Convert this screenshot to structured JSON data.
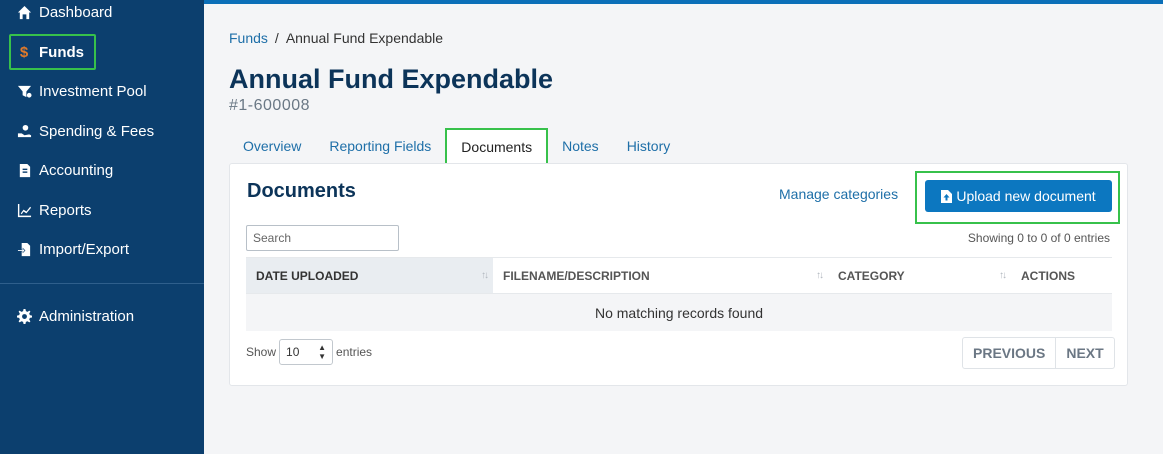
{
  "sidebar": {
    "items": [
      {
        "label": "Dashboard",
        "icon": "home-icon"
      },
      {
        "label": "Funds",
        "icon": "dollar-icon"
      },
      {
        "label": "Investment Pool",
        "icon": "funnel-icon"
      },
      {
        "label": "Spending & Fees",
        "icon": "hand-coin-icon"
      },
      {
        "label": "Accounting",
        "icon": "ledger-icon"
      },
      {
        "label": "Reports",
        "icon": "line-chart-icon"
      },
      {
        "label": "Import/Export",
        "icon": "file-transfer-icon"
      },
      {
        "label": "Administration",
        "icon": "gear-icon"
      }
    ],
    "funds_icon_glyph": "$"
  },
  "breadcrumb": {
    "parent": "Funds",
    "separator": "/",
    "current": "Annual Fund Expendable"
  },
  "page": {
    "title": "Annual Fund Expendable",
    "subtitle": "#1-600008"
  },
  "tabs": [
    {
      "label": "Overview"
    },
    {
      "label": "Reporting Fields"
    },
    {
      "label": "Documents"
    },
    {
      "label": "Notes"
    },
    {
      "label": "History"
    }
  ],
  "documents": {
    "title": "Documents",
    "manage_label": "Manage categories",
    "upload_label": "Upload new document",
    "search_placeholder": "Search",
    "showing": "Showing 0 to 0 of 0 entries",
    "columns": [
      "DATE UPLOADED",
      "FILENAME/DESCRIPTION",
      "CATEGORY",
      "ACTIONS"
    ],
    "empty_message": "No matching records found",
    "show_label": "Show",
    "page_size": "10",
    "entries_label": "entries",
    "prev_label": "PREVIOUS",
    "next_label": "NEXT"
  },
  "colors": {
    "sidebar": "#0c3f6e",
    "accent": "#0c77c0",
    "highlight": "#37c14b",
    "title": "#0c3459"
  }
}
